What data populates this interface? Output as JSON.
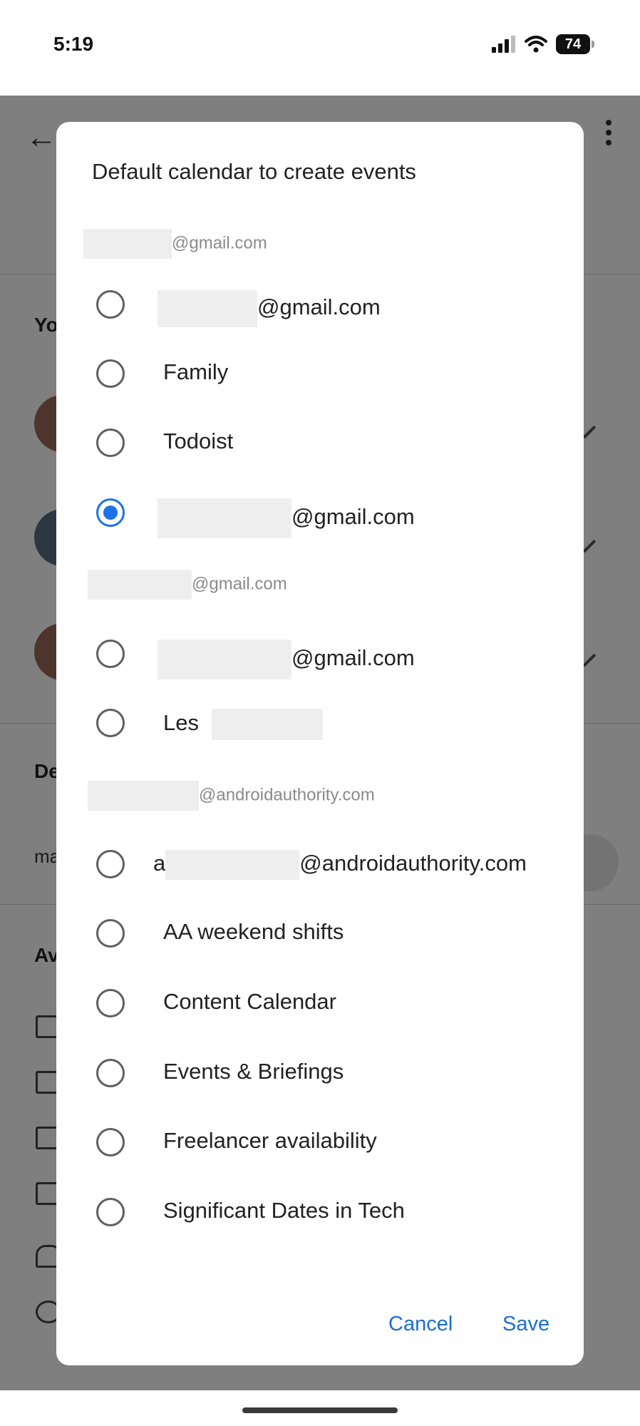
{
  "status_bar": {
    "time": "5:19",
    "battery": "74"
  },
  "dialog": {
    "title": "Default calendar to create events",
    "groups": [
      {
        "account": "@gmail.com",
        "items": [
          {
            "label": "@gmail.com",
            "selected": false
          },
          {
            "label": "Family",
            "selected": false
          },
          {
            "label": "Todoist",
            "selected": false
          },
          {
            "label": "@gmail.com",
            "selected": true
          }
        ]
      },
      {
        "account": "@gmail.com",
        "items": [
          {
            "label": "@gmail.com",
            "selected": false
          },
          {
            "label": "Les",
            "selected": false
          }
        ]
      },
      {
        "account": "@androidauthority.com",
        "items": [
          {
            "label_prefix": "a",
            "label": "@androidauthority.com",
            "selected": false
          },
          {
            "label": "AA weekend shifts",
            "selected": false
          },
          {
            "label": "Content Calendar",
            "selected": false
          },
          {
            "label": "Events & Briefings",
            "selected": false
          },
          {
            "label": "Freelancer availability",
            "selected": false
          },
          {
            "label": "Significant Dates in Tech",
            "selected": false
          }
        ]
      }
    ],
    "cancel_label": "Cancel",
    "save_label": "Save"
  },
  "background": {
    "labels": [
      "Yo",
      "De",
      "Av"
    ],
    "text": "ma"
  },
  "colors": {
    "accent": "#1a73e8",
    "button_text": "#1a6fd0",
    "scrim": "rgba(0,0,0,0.5)"
  }
}
